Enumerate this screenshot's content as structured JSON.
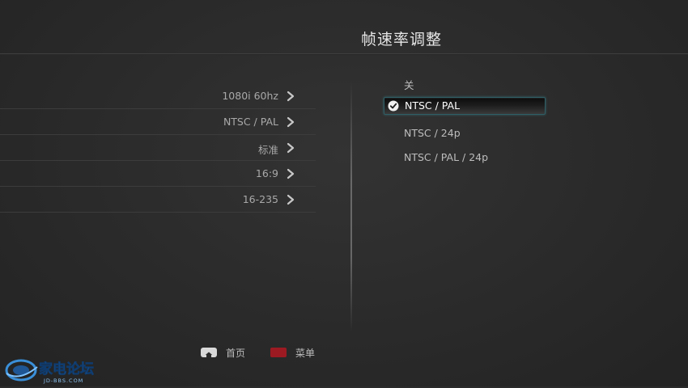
{
  "header": {
    "title": "帧速率调整"
  },
  "settings": [
    {
      "value": "1080i 60hz"
    },
    {
      "value": "NTSC / PAL"
    },
    {
      "value": "标准"
    },
    {
      "value": "16:9"
    },
    {
      "value": "16-235"
    }
  ],
  "options": [
    {
      "label": "关",
      "selected": false
    },
    {
      "label": "NTSC / PAL",
      "selected": true
    },
    {
      "label": "NTSC / 24p",
      "selected": false
    },
    {
      "label": "NTSC / PAL / 24p",
      "selected": false
    }
  ],
  "footer": {
    "home_label": "首页",
    "menu_label": "菜单"
  },
  "watermark": {
    "text": "家电论坛",
    "url_text": "JD-BBS.COM"
  },
  "colors": {
    "selection_border": "#2f5f66",
    "menu_button": "#9c1a22",
    "home_button": "#d9d9d9"
  }
}
